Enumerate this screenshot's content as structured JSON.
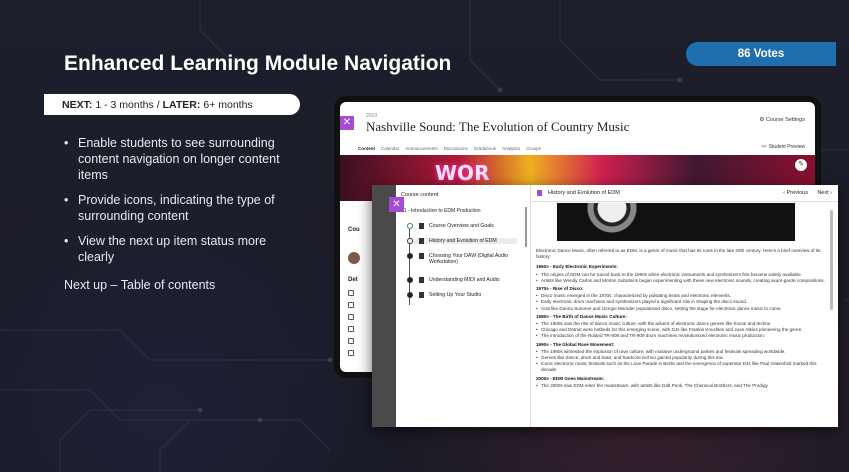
{
  "slide": {
    "title": "Enhanced Learning Module Navigation",
    "votes": "86 Votes",
    "timeline": {
      "next_label": "NEXT:",
      "next_value": "1 - 3 months",
      "sep": "/",
      "later_label": "LATER:",
      "later_value": "6+ months"
    },
    "bullets": [
      "Enable students to see surrounding content navigation on longer content items",
      "Provide icons, indicating the type of surrounding content",
      "View the next up item status more clearly"
    ],
    "next_up": "Next up – Table of contents"
  },
  "course": {
    "code": "2023",
    "name": "Nashville Sound: The Evolution of Country Music",
    "settings": "Course Settings",
    "student_preview": "Student Preview",
    "tabs": [
      "Content",
      "Calendar",
      "Announcements",
      "Discussions",
      "Gradebook",
      "Analytics",
      "Groups"
    ],
    "banner_sign": "WOR",
    "section_partial": "Cou",
    "details_partial": "Det"
  },
  "panel": {
    "sidebar_title": "Course content",
    "module_title": "01 - Introduction to EDM Production",
    "items": [
      {
        "label": "Course Overview and Goals",
        "status": "done"
      },
      {
        "label": "History and Evolution of EDM",
        "status": "current"
      },
      {
        "label": "Choosing Your DAW (Digital Audio Workstation)",
        "status": "todo"
      },
      {
        "label": "Understanding MIDI and Audio",
        "status": "todo"
      },
      {
        "label": "Setting Up Your Studio",
        "status": "todo"
      }
    ],
    "content_title": "History and Evolution of EDM",
    "prev_label": "‹ Previous",
    "next_label": "Next ›",
    "intro": "Electronic Dance Music, often referred to as EDM, is a genre of music that has its roots in the late 20th century. Here's a brief overview of its history:",
    "sections": [
      {
        "heading": "1960s - Early Electronic Experiments:",
        "points": [
          "The origins of EDM can be traced back to the 1960s when electronic instruments and synthesizers first became widely available.",
          "Artists like Wendy Carlos and Morton Subotnick began experimenting with these new electronic sounds, creating avant-garde compositions."
        ]
      },
      {
        "heading": "1970s - Rise of Disco:",
        "points": [
          "Disco music emerged in the 1970s, characterized by pulsating beats and electronic elements.",
          "Early electronic drum machines and synthesizers played a significant role in shaping the disco sound.",
          "Acts like Donna Summer and Giorgio Moroder popularized disco, setting the stage for electronic dance music to come."
        ]
      },
      {
        "heading": "1980s - The Birth of Dance Music Culture:",
        "points": [
          "The 1980s saw the rise of dance music culture, with the advent of electronic dance genres like house and techno.",
          "Chicago and Detroit were hotbeds for this emerging scene, with DJs like Frankie Knuckles and Juan Atkins pioneering the genre.",
          "The introduction of the Roland TR-808 and TR-909 drum machines revolutionized electronic music production."
        ]
      },
      {
        "heading": "1990s - The Global Rave Movement:",
        "points": [
          "The 1990s witnessed the explosion of rave culture, with massive underground parties and festivals spreading worldwide.",
          "Genres like trance, drum and bass, and hardcore techno gained popularity during this era.",
          "Iconic electronic music festivals such as the Love Parade in Berlin and the emergence of superstar DJs like Paul Oakenfold marked this decade."
        ]
      },
      {
        "heading": "2000s - EDM Goes Mainstream:",
        "points": [
          "The 2000s saw EDM enter the mainstream, with artists like Daft Punk, The Chemical Brothers, and The Prodigy"
        ]
      }
    ]
  },
  "colors": {
    "accent_purple": "#a64bd6",
    "votes_blue": "#1f6fae",
    "background": "#1b1d29"
  }
}
